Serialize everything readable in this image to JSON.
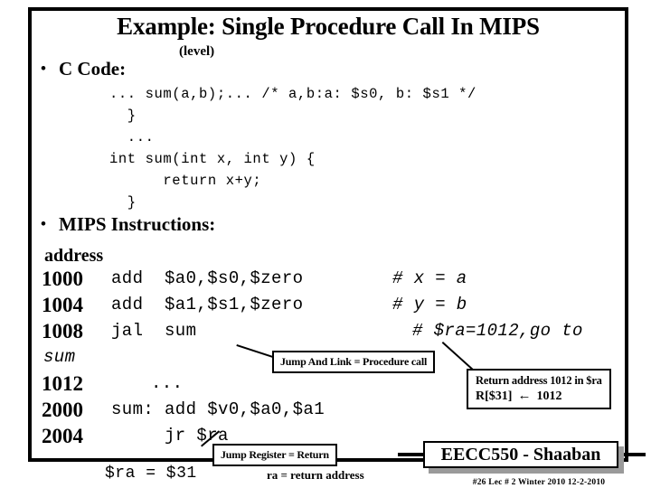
{
  "slide": {
    "title": "Example: Single Procedure Call In MIPS",
    "subtitle": "(level)",
    "bullet_glyph": "•"
  },
  "sections": {
    "c_code": {
      "heading": "C Code:",
      "code": "... sum(a,b);... /* a,b:a: $s0, b: $s1 */\n  }\n  ...\nint sum(int x, int y) {\n      return x+y;\n  }"
    },
    "mips": {
      "heading": "MIPS Instructions:",
      "address_label": "address",
      "rows": [
        {
          "address": "1000",
          "instruction": "add  $a0,$s0,$zero",
          "comment": "# x = a"
        },
        {
          "address": "1004",
          "instruction": "add  $a1,$s1,$zero",
          "comment": "# y = b"
        },
        {
          "address": "1008",
          "instruction": "jal  sum",
          "comment": "# $ra=1012,go to"
        },
        {
          "address": "",
          "instruction": "",
          "comment": "",
          "italic_label": "sum"
        },
        {
          "address": "1012",
          "instruction": "...",
          "comment": ""
        },
        {
          "address": "2000",
          "instruction": "sum: add $v0,$a0,$a1",
          "comment": ""
        },
        {
          "address": "2004",
          "instruction": "     jr $ra",
          "comment": ""
        }
      ]
    }
  },
  "callouts": {
    "jal": "Jump And Link = Procedure call",
    "jr": "Jump Register = Return",
    "return_address": {
      "line1": "Return address 1012 in  $ra",
      "reg": "R[$31]",
      "arrow": "←",
      "value": "1012"
    }
  },
  "annotations": {
    "ra_equals": "$ra = $31",
    "ra_meaning": "ra = return address"
  },
  "footer": {
    "course": "EECC550 - Shaaban",
    "meta": "#26   Lec # 2  Winter 2010  12-2-2010"
  },
  "colors": {
    "ink": "#000000",
    "paper": "#ffffff",
    "shadow": "#9a9a9a"
  }
}
